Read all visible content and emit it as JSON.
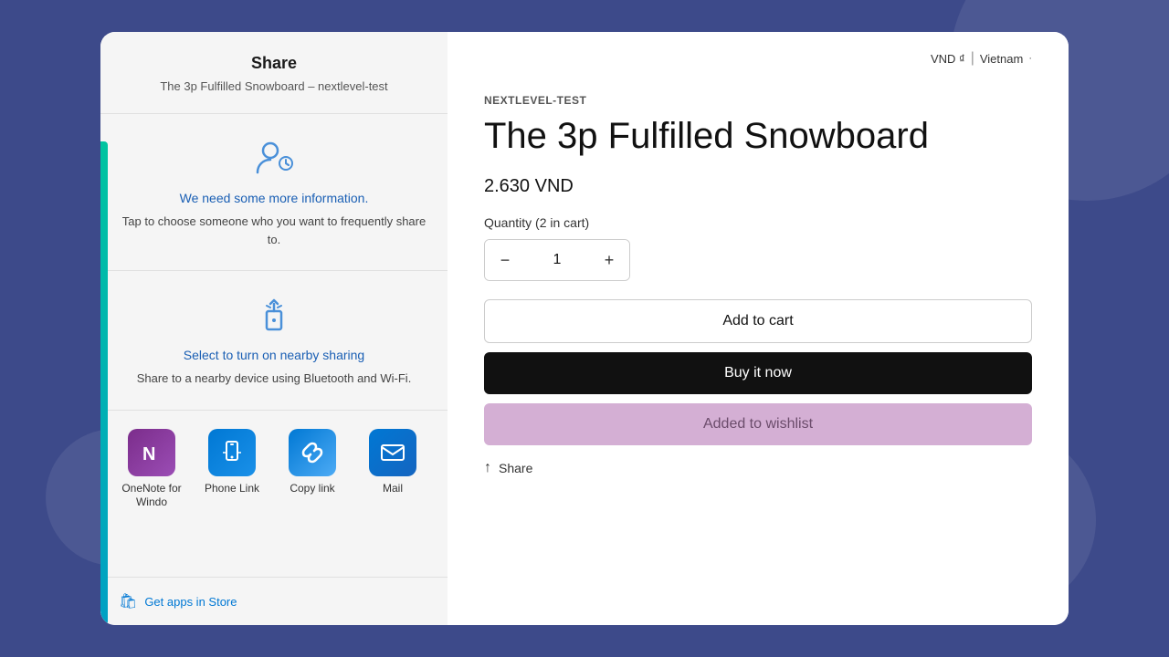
{
  "background": {
    "color": "#3d4a8a"
  },
  "share_panel": {
    "header": {
      "title": "Share",
      "subtitle": "The 3p Fulfilled Snowboard – nextlevel-test"
    },
    "contact_section": {
      "title": "We need some more information.",
      "description": "Tap to choose someone who you want to frequently share to."
    },
    "nearby_section": {
      "title": "Select to turn on nearby sharing",
      "description": "Share to a nearby device using Bluetooth and Wi-Fi."
    },
    "apps": [
      {
        "id": "onenote",
        "label": "OneNote for Windo",
        "icon_type": "onenote"
      },
      {
        "id": "phonelink",
        "label": "Phone Link",
        "icon_type": "phonelink"
      },
      {
        "id": "copylink",
        "label": "Copy link",
        "icon_type": "copylink"
      },
      {
        "id": "mail",
        "label": "Mail",
        "icon_type": "mail"
      }
    ],
    "get_apps_label": "Get apps in Store"
  },
  "product_panel": {
    "locale": {
      "currency": "VND ₫",
      "separator": "|",
      "country": "Vietnam",
      "arrow": "·"
    },
    "brand": "NEXTLEVEL-TEST",
    "title": "The 3p Fulfilled Snowboard",
    "price": "2.630 VND",
    "quantity_label": "Quantity (2 in cart)",
    "quantity_value": "1",
    "buttons": {
      "add_to_cart": "Add to cart",
      "buy_now": "Buy it now",
      "wishlist": "Added to wishlist",
      "share": "Share"
    }
  }
}
